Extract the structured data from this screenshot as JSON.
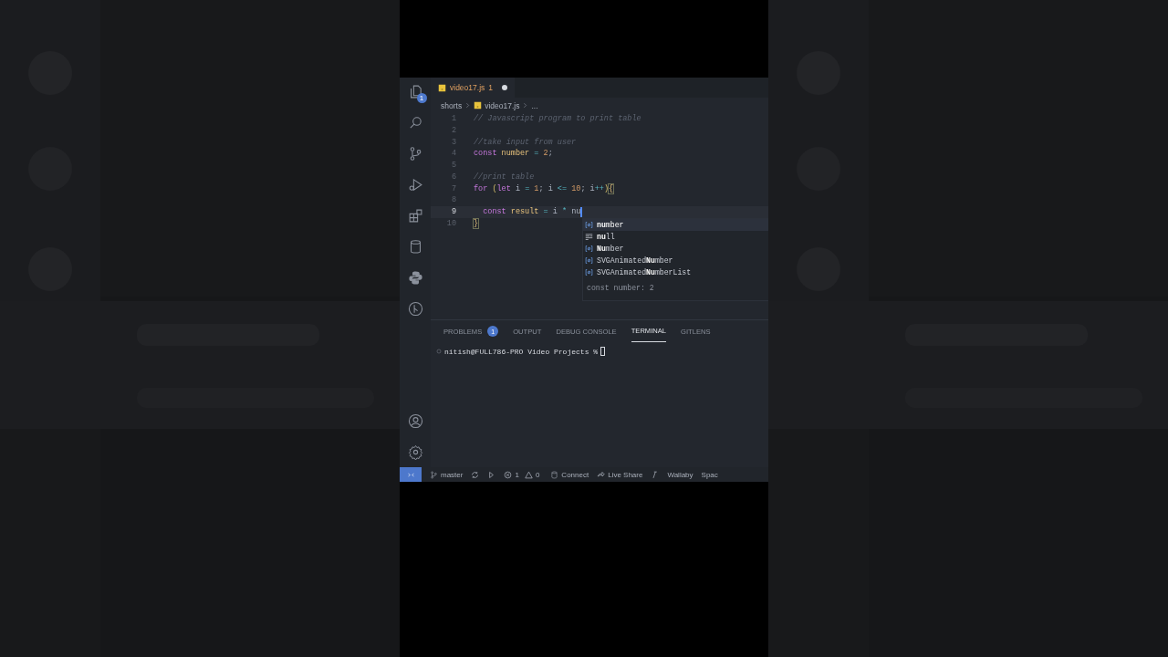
{
  "tab": {
    "title": "video17.js",
    "problems": "1",
    "modified": true
  },
  "breadcrumb": [
    {
      "kind": "folder",
      "text": "shorts"
    },
    {
      "kind": "file",
      "text": "video17.js"
    },
    {
      "kind": "more",
      "text": "..."
    }
  ],
  "activity_bar": [
    {
      "kind": "files",
      "badge": "1"
    },
    {
      "kind": "search"
    },
    {
      "kind": "source-control"
    },
    {
      "kind": "run"
    },
    {
      "kind": "extensions"
    },
    {
      "kind": "database"
    },
    {
      "kind": "python"
    },
    {
      "kind": "git-graph"
    }
  ],
  "activity_bar_bottom": [
    {
      "kind": "account"
    },
    {
      "kind": "settings"
    }
  ],
  "editor": {
    "lines": [
      {
        "number": "1",
        "current": false,
        "tokens": [
          {
            "text": "// Javascript program to print table",
            "kind": "comment"
          }
        ]
      },
      {
        "number": "2",
        "current": false
      },
      {
        "number": "3",
        "current": false,
        "tokens": [
          {
            "text": "//take input from user",
            "kind": "comment"
          }
        ]
      },
      {
        "number": "4",
        "current": false,
        "tokens": [
          {
            "text": "const",
            "kind": "keyword"
          },
          {
            "text": " number ",
            "kind": "var"
          },
          {
            "text": "=",
            "kind": "op"
          },
          {
            "text": " 2",
            "kind": "num"
          },
          {
            "text": ";",
            "kind": "plain"
          }
        ]
      },
      {
        "number": "5",
        "current": false
      },
      {
        "number": "6",
        "current": false,
        "tokens": [
          {
            "text": "//print table",
            "kind": "comment"
          }
        ]
      },
      {
        "number": "7",
        "current": false,
        "tokens": [
          {
            "text": "for",
            "kind": "keyword"
          },
          {
            "text": " (",
            "kind": "bracket"
          },
          {
            "text": "let",
            "kind": "keyword"
          },
          {
            "text": " i ",
            "kind": "plain"
          },
          {
            "text": "=",
            "kind": "op"
          },
          {
            "text": " 1",
            "kind": "num"
          },
          {
            "text": "; i ",
            "kind": "plain"
          },
          {
            "text": "<=",
            "kind": "op"
          },
          {
            "text": " 10",
            "kind": "num"
          },
          {
            "text": "; i",
            "kind": "plain"
          },
          {
            "text": "++",
            "kind": "op"
          },
          {
            "text": ")",
            "kind": "bracket"
          },
          {
            "text": "{",
            "kind": "match"
          }
        ]
      },
      {
        "number": "8",
        "current": false
      },
      {
        "number": "9",
        "current": true,
        "tokens": [
          {
            "text": "  const",
            "kind": "keyword"
          },
          {
            "text": " result ",
            "kind": "var"
          },
          {
            "text": "=",
            "kind": "op"
          },
          {
            "text": " i ",
            "kind": "plain"
          },
          {
            "text": "*",
            "kind": "op"
          },
          {
            "text": " nu",
            "kind": "plain"
          }
        ]
      },
      {
        "number": "10",
        "current": false,
        "tokens": [
          {
            "text": "}",
            "kind": "match"
          }
        ]
      }
    ]
  },
  "suggestions": {
    "items": [
      {
        "label": "**nu**mber",
        "kind": "variable",
        "selected": true
      },
      {
        "label": "**nu**ll",
        "kind": "keyword",
        "selected": false
      },
      {
        "label": "**Nu**mber",
        "kind": "variable",
        "selected": false
      },
      {
        "label": "SVGAnimated**Nu**mber",
        "kind": "variable",
        "selected": false
      },
      {
        "label": "SVGAnimated**Nu**mberList",
        "kind": "variable",
        "selected": false
      }
    ],
    "detail": "const number: 2"
  },
  "panel": {
    "tabs": [
      {
        "label": "PROBLEMS",
        "badge": "1",
        "selected": false
      },
      {
        "label": "OUTPUT",
        "selected": false
      },
      {
        "label": "DEBUG CONSOLE",
        "selected": false
      },
      {
        "label": "TERMINAL",
        "selected": true
      },
      {
        "label": "GITLENS",
        "selected": false
      }
    ],
    "terminal": {
      "prompt": "nitish@FULL786-PRO Video Projects %"
    }
  },
  "status_bar": [
    {
      "kind": "remote"
    },
    {
      "kind": "branch",
      "text": "master"
    },
    {
      "kind": "sync"
    },
    {
      "kind": "debug"
    },
    {
      "kind": "problems",
      "errors": "1",
      "warnings": "0"
    },
    {
      "kind": "connect",
      "text": "Connect"
    },
    {
      "kind": "liveshare",
      "text": "Live Share"
    },
    {
      "kind": "wallaby"
    },
    {
      "kind": "text",
      "text": "Wallaby"
    },
    {
      "kind": "text",
      "text": "Spac"
    }
  ]
}
